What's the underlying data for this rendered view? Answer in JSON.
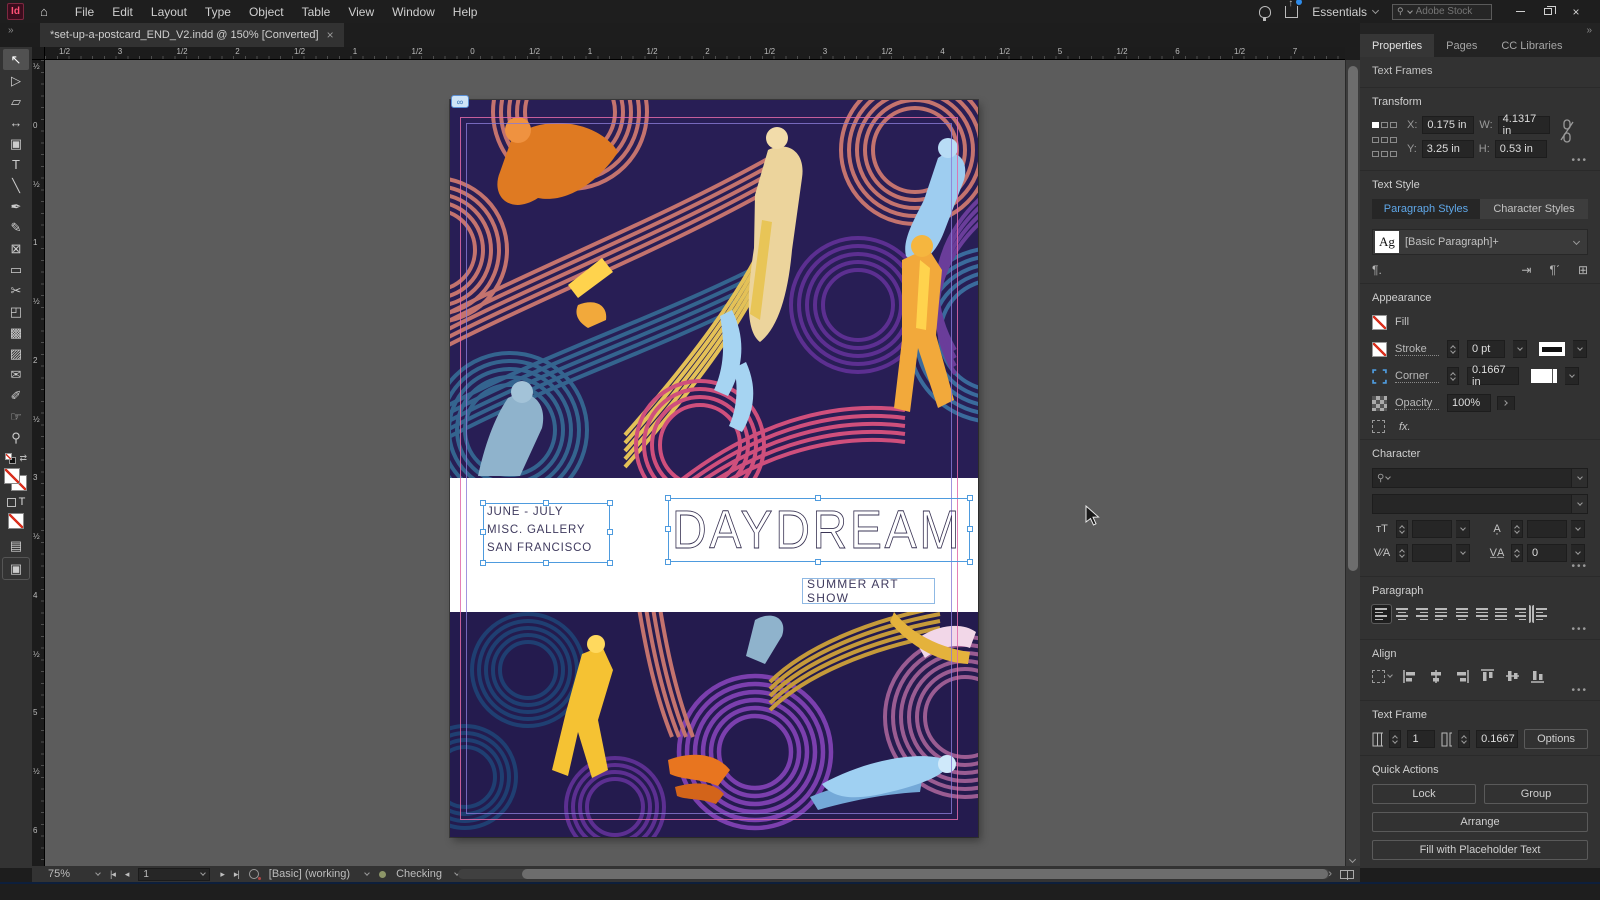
{
  "window": {
    "search_placeholder": "Adobe Stock",
    "workspace": "Essentials",
    "expand_more": "»",
    "close_glyph": "×"
  },
  "menubar": {
    "logo": "Id",
    "home_glyph": "⌂",
    "items": [
      "File",
      "Edit",
      "Layout",
      "Type",
      "Object",
      "Table",
      "View",
      "Window",
      "Help"
    ]
  },
  "tabbar": {
    "document_title": "*set-up-a-postcard_END_V2.indd @ 150% [Converted]",
    "close": "×"
  },
  "panel_tabs": {
    "properties": "Properties",
    "pages": "Pages",
    "cc_libraries": "CC Libraries"
  },
  "toolbar": {
    "tools": [
      {
        "name": "selection-tool",
        "glyph": "↖"
      },
      {
        "name": "direct-selection-tool",
        "glyph": "▷"
      },
      {
        "name": "page-tool",
        "glyph": "▱"
      },
      {
        "name": "gap-tool",
        "glyph": "↔"
      },
      {
        "name": "content-collector-tool",
        "glyph": "▣"
      },
      {
        "name": "type-tool",
        "glyph": "T"
      },
      {
        "name": "line-tool",
        "glyph": "╲"
      },
      {
        "name": "pen-tool",
        "glyph": "✒"
      },
      {
        "name": "pencil-tool",
        "glyph": "✎"
      },
      {
        "name": "frame-tool",
        "glyph": "⊠"
      },
      {
        "name": "rectangle-tool",
        "glyph": "▭"
      },
      {
        "name": "scissors-tool",
        "glyph": "✂"
      },
      {
        "name": "free-transform-tool",
        "glyph": "◰"
      },
      {
        "name": "gradient-swatch-tool",
        "glyph": "▩"
      },
      {
        "name": "gradient-feather-tool",
        "glyph": "▨"
      },
      {
        "name": "note-tool",
        "glyph": "✉"
      },
      {
        "name": "eyedropper-tool",
        "glyph": "✐"
      },
      {
        "name": "hand-tool",
        "glyph": "☞"
      },
      {
        "name": "zoom-tool",
        "glyph": "⚲"
      }
    ],
    "swap_glyph": "⇄",
    "text_toggle": "T",
    "view_glyph": "▤",
    "screen_mode_glyph": "▣"
  },
  "ruler_h": {
    "labels": [
      "1/2",
      "3",
      "1/2",
      "2",
      "1/2",
      "1",
      "1/2",
      "0",
      "1/2",
      "1",
      "1/2",
      "2",
      "1/2",
      "3",
      "1/2",
      "4",
      "1/2",
      "5",
      "1/2",
      "6",
      "1/2",
      "7"
    ]
  },
  "ruler_v": {
    "labels": [
      "½",
      "0",
      "½",
      "1",
      "½",
      "2",
      "½",
      "3",
      "½",
      "4",
      "½",
      "5",
      "½",
      "6"
    ]
  },
  "canvas": {
    "postcard": {
      "line1": "JUNE - JULY",
      "line2": "MISC. GALLERY",
      "line3": "SAN FRANCISCO",
      "title": "DAYDREAM",
      "subtitle": "SUMMER ART SHOW"
    },
    "link_badge": "∞"
  },
  "properties_panel": {
    "header": "Text Frames",
    "transform": {
      "title": "Transform",
      "x_label": "X:",
      "x_value": "0.175 in",
      "y_label": "Y:",
      "y_value": "3.25 in",
      "w_label": "W:",
      "w_value": "4.1317 in",
      "h_label": "H:",
      "h_value": "0.53 in"
    },
    "text_style": {
      "title": "Text Style",
      "tab_paragraph": "Paragraph Styles",
      "tab_character": "Character Styles",
      "sample": "Ag",
      "style_name": "[Basic Paragraph]+",
      "icon_pilcrow": "¶.",
      "icon_redefine": "⇥",
      "icon_edit": "¶ˊ",
      "icon_new": "⊞"
    },
    "appearance": {
      "title": "Appearance",
      "fill_label": "Fill",
      "stroke_label": "Stroke",
      "stroke_value": "0 pt",
      "corner_label": "Corner",
      "corner_value": "0.1667 in",
      "opacity_label": "Opacity",
      "opacity_value": "100%",
      "fx_label": "fx."
    },
    "character": {
      "title": "Character",
      "size_icon": "тT",
      "leading_icon": "A͎",
      "kerning_icon": "V∕A",
      "tracking_icon": "V̲A̲",
      "tracking_value": "0"
    },
    "paragraph": {
      "title": "Paragraph"
    },
    "align": {
      "title": "Align"
    },
    "text_frame": {
      "title": "Text Frame",
      "columns_value": "1",
      "inset_value": "0.1667",
      "options_label": "Options"
    },
    "quick_actions": {
      "title": "Quick Actions",
      "lock": "Lock",
      "group": "Group",
      "arrange": "Arrange",
      "fill_placeholder": "Fill with Placeholder Text"
    }
  },
  "statusbar": {
    "zoom": "75%",
    "first": "|◂",
    "prev": "◂",
    "page": "1",
    "next": "▸",
    "last": "▸|",
    "preset": "[Basic] (working)",
    "status": "Checking",
    "scroll_left": "‹",
    "scroll_right": "›"
  },
  "colors": {
    "selection_blue": "#4e9bde",
    "guide_pink": "#e06aa8",
    "guide_violet": "#8a7ae0",
    "artwork_bg": "#281e55",
    "logo_pink": "#ff5277"
  }
}
